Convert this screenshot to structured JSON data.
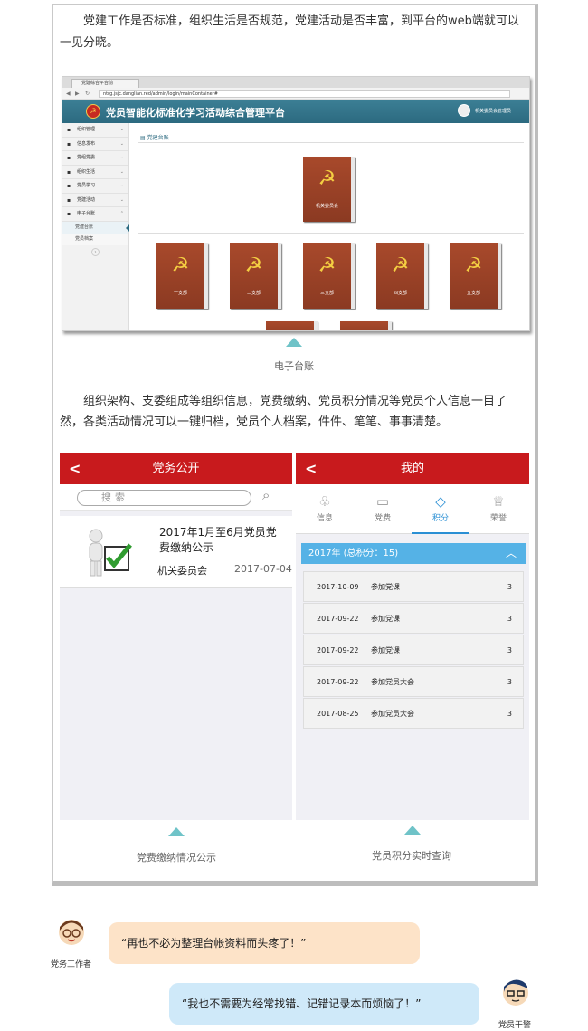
{
  "intro_text": "党建工作是否标准，组织生活是否规范，党建活动是否丰富，到平台的web端就可以一见分晓。",
  "browser": {
    "tab_title": "党建综合平台前",
    "url": "ntrg.jsjc.danglian.red/admin/login/mainContainer#",
    "app_title": "党员智能化标准化学习活动综合管理平台",
    "user_label": "机关委员会管理员",
    "sidebar_items": [
      "组织管理",
      "信息发布",
      "党组党委",
      "组织生活",
      "党员学习",
      "党建活动",
      "电子台账"
    ],
    "sidebar_sub": [
      "党建台账",
      "党员档案"
    ],
    "content_title": "党建台账",
    "top_book": "机关委员会",
    "books": [
      "一支部",
      "二支部",
      "三支部",
      "四支部",
      "五支部"
    ]
  },
  "caption_1": "电子台账",
  "middle_text": "组织架构、支委组成等组织信息，党费缴纳、党员积分情况等党员个人信息一目了然，各类活动情况可以一键归档，党员个人档案，件件、笔笔、事事清楚。",
  "phone_left": {
    "title": "党务公开",
    "search_placeholder": "搜索",
    "item_title": "2017年1月至6月党员党费缴纳公示",
    "item_org": "机关委员会",
    "item_date": "2017-07-04"
  },
  "phone_right": {
    "title": "我的",
    "tabs": [
      "信息",
      "党费",
      "积分",
      "荣誉"
    ],
    "year_summary": "2017年   (总积分：15)",
    "records": [
      {
        "date": "2017-10-09",
        "activity": "参加党课",
        "score": "3"
      },
      {
        "date": "2017-09-22",
        "activity": "参加党课",
        "score": "3"
      },
      {
        "date": "2017-09-22",
        "activity": "参加党课",
        "score": "3"
      },
      {
        "date": "2017-09-22",
        "activity": "参加党员大会",
        "score": "3"
      },
      {
        "date": "2017-08-25",
        "activity": "参加党员大会",
        "score": "3"
      }
    ]
  },
  "caption_2": "党费缴纳情况公示",
  "caption_3": "党员积分实时查询",
  "chat": {
    "worker_role": "党务工作者",
    "worker_quote": "“再也不必为整理台帐资料而头疼了！”",
    "cadre_role": "党员干警",
    "cadre_quote": "“我也不需要为经常找错、记错记录本而烦恼了！”"
  },
  "colors": {
    "party_red": "#c81a1d",
    "teal": "#2c6a80",
    "accent_blue": "#55b2e6",
    "bubble_orange": "#fde3c8",
    "bubble_blue": "#cfe9f9"
  }
}
